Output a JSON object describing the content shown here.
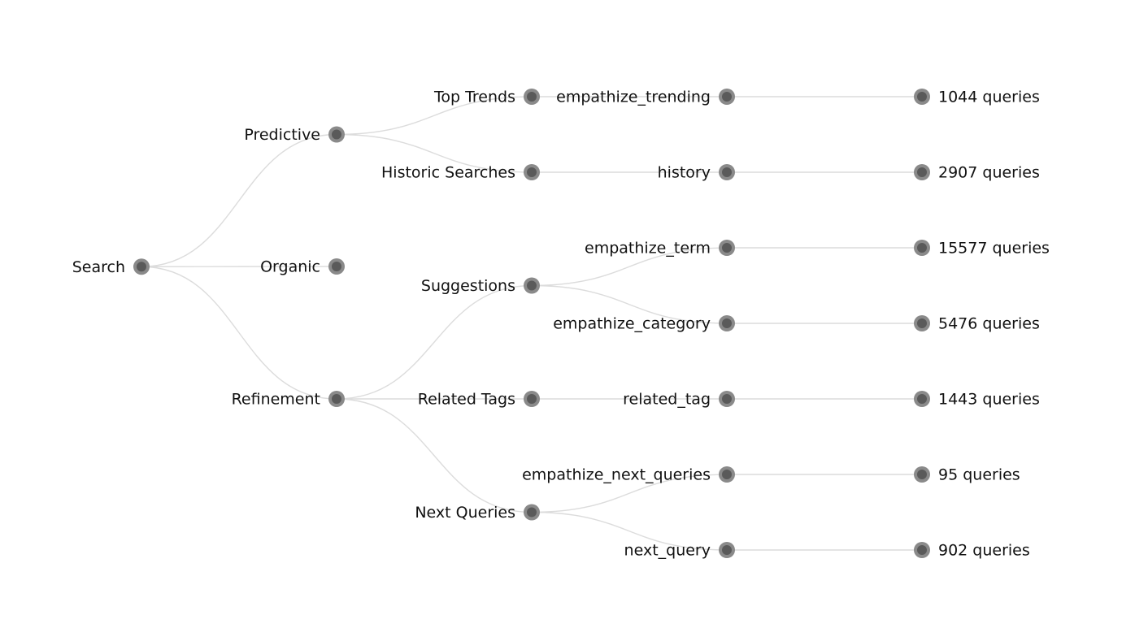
{
  "diagram": {
    "type": "tree",
    "orientation": "left-to-right",
    "colors": {
      "edge": "#dcdcdc",
      "node_outer": "#8a8a8a",
      "node_inner": "#5a5a5a",
      "label": "#111111"
    },
    "root": {
      "id": "search",
      "label": "Search",
      "children": [
        {
          "id": "predictive",
          "label": "Predictive",
          "children": [
            {
              "id": "top-trends",
              "label": "Top Trends",
              "children": [
                {
                  "id": "empathize-trending",
                  "label": "empathize_trending",
                  "children": [
                    {
                      "id": "queries-1044",
                      "label": "1044 queries",
                      "children": []
                    }
                  ]
                }
              ]
            },
            {
              "id": "historic-searches",
              "label": "Historic Searches",
              "children": [
                {
                  "id": "history",
                  "label": "history",
                  "children": [
                    {
                      "id": "queries-2907",
                      "label": "2907 queries",
                      "children": []
                    }
                  ]
                }
              ]
            }
          ]
        },
        {
          "id": "organic",
          "label": "Organic",
          "children": []
        },
        {
          "id": "refinement",
          "label": "Refinement",
          "children": [
            {
              "id": "suggestions",
              "label": "Suggestions",
              "children": [
                {
                  "id": "empathize-term",
                  "label": "empathize_term",
                  "children": [
                    {
                      "id": "queries-15577",
                      "label": "15577 queries",
                      "children": []
                    }
                  ]
                },
                {
                  "id": "empathize-category",
                  "label": "empathize_category",
                  "children": [
                    {
                      "id": "queries-5476",
                      "label": "5476 queries",
                      "children": []
                    }
                  ]
                }
              ]
            },
            {
              "id": "related-tags",
              "label": "Related Tags",
              "children": [
                {
                  "id": "related-tag",
                  "label": "related_tag",
                  "children": [
                    {
                      "id": "queries-1443",
                      "label": "1443 queries",
                      "children": []
                    }
                  ]
                }
              ]
            },
            {
              "id": "next-queries",
              "label": "Next Queries",
              "children": [
                {
                  "id": "empathize-next-queries",
                  "label": "empathize_next_queries",
                  "children": [
                    {
                      "id": "queries-95",
                      "label": "95 queries",
                      "children": []
                    }
                  ]
                },
                {
                  "id": "next-query",
                  "label": "next_query",
                  "children": [
                    {
                      "id": "queries-902",
                      "label": "902 queries",
                      "children": []
                    }
                  ]
                }
              ]
            }
          ]
        }
      ]
    }
  }
}
